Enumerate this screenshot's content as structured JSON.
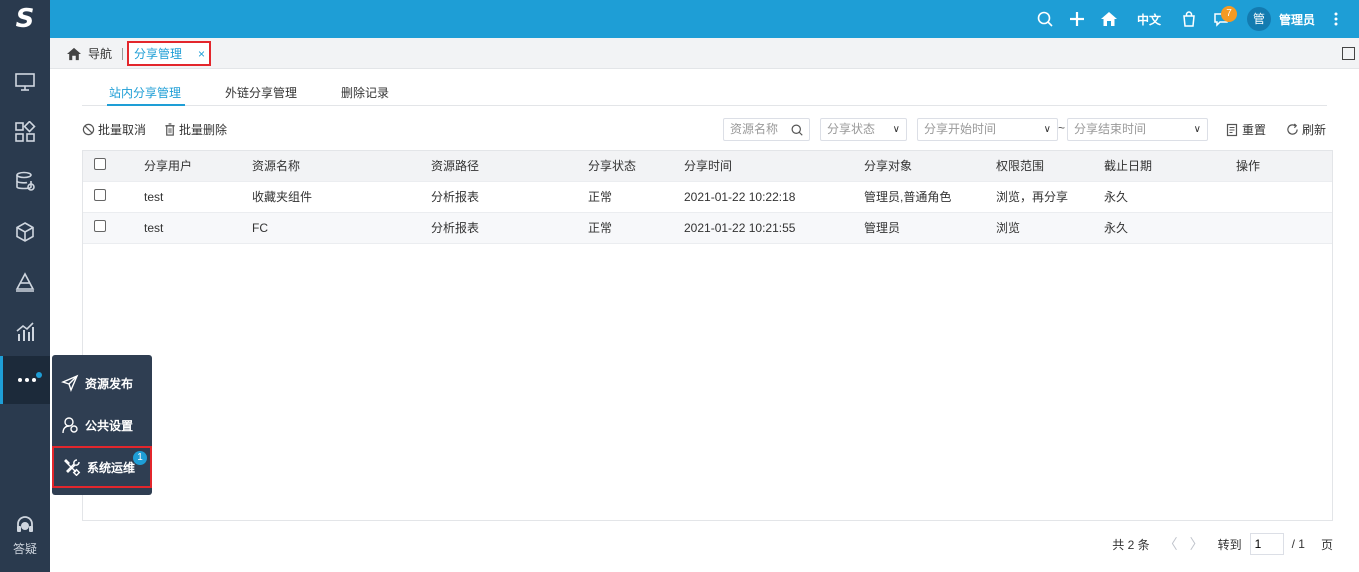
{
  "colors": {
    "primary": "#1e9ed6",
    "sidebar": "#2a3a4e",
    "highlight": "#e3262c",
    "badge": "#f59a23"
  },
  "logo": {
    "mark": "S"
  },
  "sidebar": {
    "icons": [
      "monitor-icon",
      "grid-apps-icon",
      "database-gear-icon",
      "cube-icon",
      "layers-icon",
      "bar-chart-icon",
      "more-dots-icon"
    ],
    "help_label": "答疑"
  },
  "topbar": {
    "lang": "中文",
    "message_count": "7",
    "avatar_text": "管",
    "user_name": "管理员"
  },
  "tabstrip": {
    "home_label": "导航",
    "open_tab": "分享管理",
    "close": "×"
  },
  "subtabs": [
    "站内分享管理",
    "外链分享管理",
    "删除记录"
  ],
  "toolbar": {
    "batch_cancel": "批量取消",
    "batch_delete": "批量删除",
    "resource_name_placeholder": "资源名称",
    "share_status_placeholder": "分享状态",
    "start_time_placeholder": "分享开始时间",
    "tilde": "~",
    "end_time_placeholder": "分享结束时间",
    "reset": "重置",
    "refresh": "刷新"
  },
  "table": {
    "headers": [
      "分享用户",
      "资源名称",
      "资源路径",
      "分享状态",
      "分享时间",
      "分享对象",
      "权限范围",
      "截止日期",
      "操作"
    ],
    "rows": [
      [
        "test",
        "收藏夹组件",
        "分析报表",
        "正常",
        "2021-01-22 10:22:18",
        "管理员,普通角色",
        "浏览，再分享",
        "永久",
        ""
      ],
      [
        "test",
        "FC",
        "分析报表",
        "正常",
        "2021-01-22 10:21:55",
        "管理员",
        "浏览",
        "永久",
        ""
      ]
    ]
  },
  "pager": {
    "total": "共 2 条",
    "goto": "转到",
    "page_value": "1",
    "slash_total": "/ 1",
    "page_unit": "页"
  },
  "popover": {
    "items": [
      {
        "label": "资源发布",
        "icon": "send-icon"
      },
      {
        "label": "公共设置",
        "icon": "settings-person-icon"
      },
      {
        "label": "系统运维",
        "icon": "tools-icon",
        "badge": "1"
      }
    ]
  }
}
